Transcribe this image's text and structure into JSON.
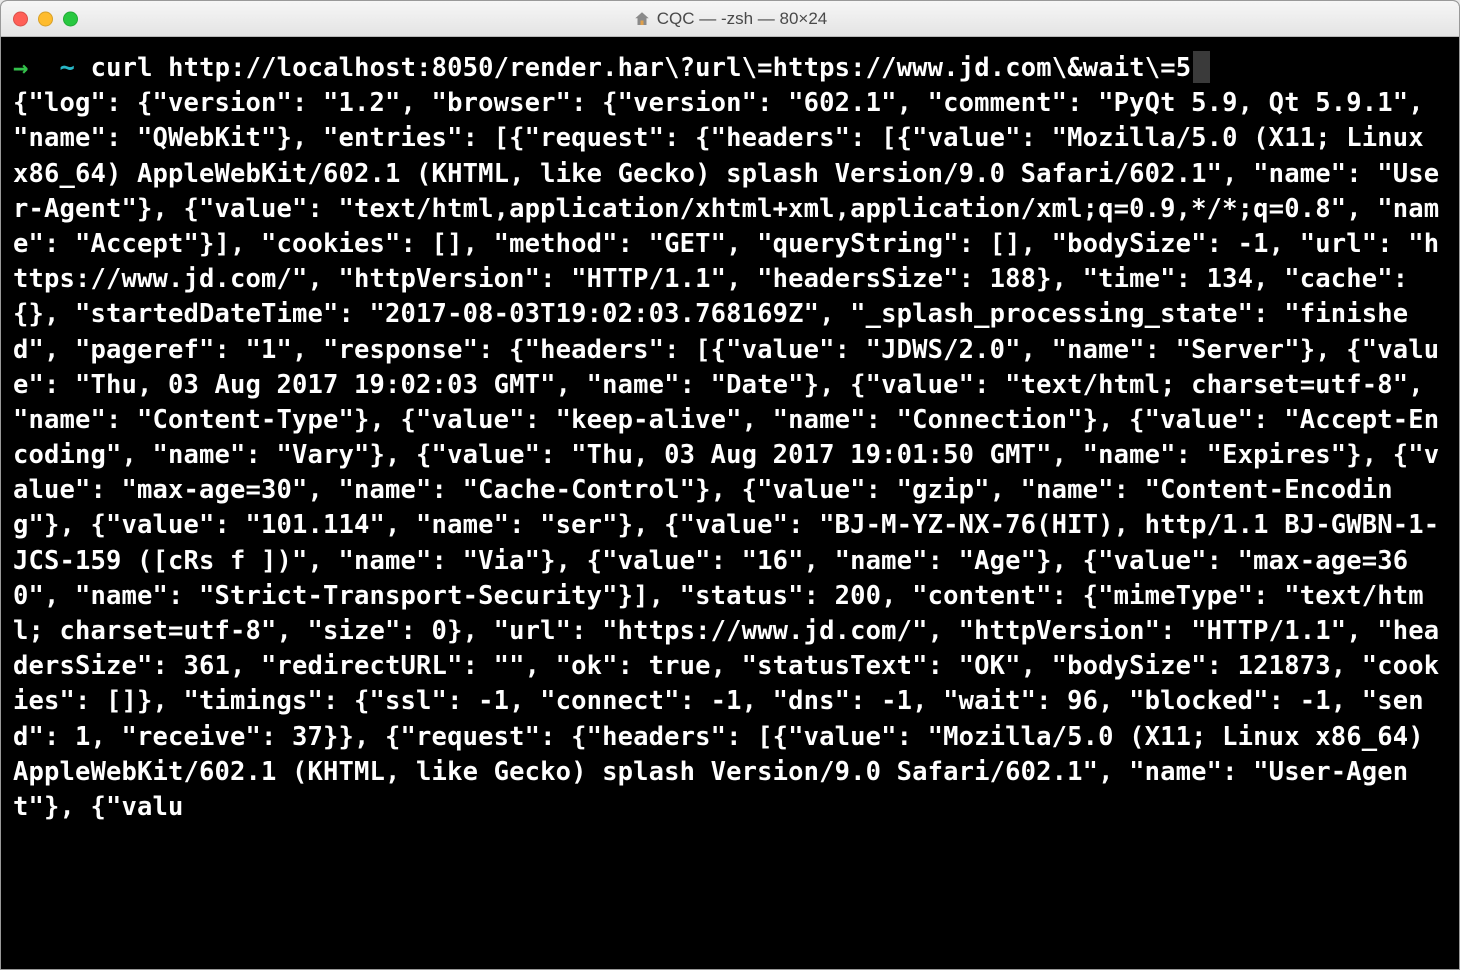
{
  "window": {
    "title": "CQC — -zsh — 80×24"
  },
  "prompt": {
    "arrow": "→",
    "tilde": "~",
    "command": "curl http://localhost:8050/render.har\\?url\\=https://www.jd.com\\&wait\\=5"
  },
  "output": "{\"log\": {\"version\": \"1.2\", \"browser\": {\"version\": \"602.1\", \"comment\": \"PyQt 5.9, Qt 5.9.1\", \"name\": \"QWebKit\"}, \"entries\": [{\"request\": {\"headers\": [{\"value\": \"Mozilla/5.0 (X11; Linux x86_64) AppleWebKit/602.1 (KHTML, like Gecko) splash Version/9.0 Safari/602.1\", \"name\": \"User-Agent\"}, {\"value\": \"text/html,application/xhtml+xml,application/xml;q=0.9,*/*;q=0.8\", \"name\": \"Accept\"}], \"cookies\": [], \"method\": \"GET\", \"queryString\": [], \"bodySize\": -1, \"url\": \"https://www.jd.com/\", \"httpVersion\": \"HTTP/1.1\", \"headersSize\": 188}, \"time\": 134, \"cache\": {}, \"startedDateTime\": \"2017-08-03T19:02:03.768169Z\", \"_splash_processing_state\": \"finished\", \"pageref\": \"1\", \"response\": {\"headers\": [{\"value\": \"JDWS/2.0\", \"name\": \"Server\"}, {\"value\": \"Thu, 03 Aug 2017 19:02:03 GMT\", \"name\": \"Date\"}, {\"value\": \"text/html; charset=utf-8\", \"name\": \"Content-Type\"}, {\"value\": \"keep-alive\", \"name\": \"Connection\"}, {\"value\": \"Accept-Encoding\", \"name\": \"Vary\"}, {\"value\": \"Thu, 03 Aug 2017 19:01:50 GMT\", \"name\": \"Expires\"}, {\"value\": \"max-age=30\", \"name\": \"Cache-Control\"}, {\"value\": \"gzip\", \"name\": \"Content-Encoding\"}, {\"value\": \"101.114\", \"name\": \"ser\"}, {\"value\": \"BJ-M-YZ-NX-76(HIT), http/1.1 BJ-GWBN-1-JCS-159 ([cRs f ])\", \"name\": \"Via\"}, {\"value\": \"16\", \"name\": \"Age\"}, {\"value\": \"max-age=360\", \"name\": \"Strict-Transport-Security\"}], \"status\": 200, \"content\": {\"mimeType\": \"text/html; charset=utf-8\", \"size\": 0}, \"url\": \"https://www.jd.com/\", \"httpVersion\": \"HTTP/1.1\", \"headersSize\": 361, \"redirectURL\": \"\", \"ok\": true, \"statusText\": \"OK\", \"bodySize\": 121873, \"cookies\": []}, \"timings\": {\"ssl\": -1, \"connect\": -1, \"dns\": -1, \"wait\": 96, \"blocked\": -1, \"send\": 1, \"receive\": 37}}, {\"request\": {\"headers\": [{\"value\": \"Mozilla/5.0 (X11; Linux x86_64) AppleWebKit/602.1 (KHTML, like Gecko) splash Version/9.0 Safari/602.1\", \"name\": \"User-Agent\"}, {\"valu"
}
